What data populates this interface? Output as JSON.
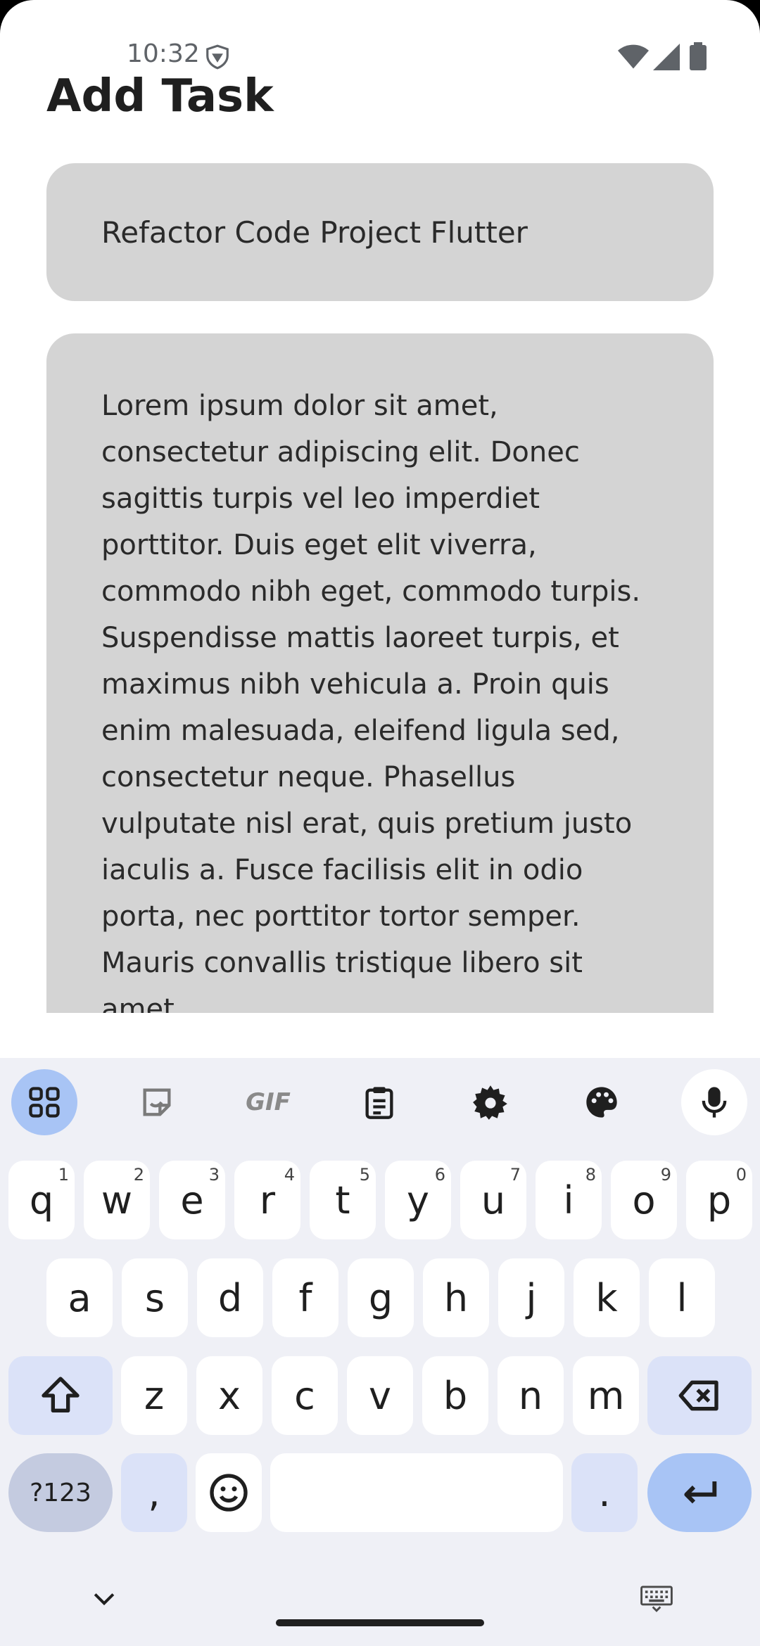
{
  "status_bar": {
    "time": "10:32"
  },
  "page": {
    "title": "Add Task"
  },
  "form": {
    "task_title_value": "Refactor Code Project Flutter",
    "description_value": "Lorem ipsum dolor sit amet, consectetur adipiscing elit. Donec sagittis turpis vel leo imperdiet porttitor. Duis eget elit viverra, commodo nibh eget, commodo turpis. Suspendisse mattis laoreet turpis, et maximus nibh vehicula a. Proin quis enim malesuada, eleifend ligula sed, consectetur neque. Phasellus vulputate nisl erat, quis pretium justo iaculis a. Fusce facilisis elit in odio porta, nec porttitor tortor semper. Mauris convallis tristique libero sit amet"
  },
  "keyboard": {
    "toolbar": {
      "apps_icon": "apps-grid-icon",
      "sticker_icon": "sticker-icon",
      "gif_label": "GIF",
      "clipboard_icon": "clipboard-icon",
      "settings_icon": "gear-icon",
      "theme_icon": "palette-icon",
      "mic_icon": "microphone-icon"
    },
    "row1": [
      {
        "key": "q",
        "hint": "1"
      },
      {
        "key": "w",
        "hint": "2"
      },
      {
        "key": "e",
        "hint": "3"
      },
      {
        "key": "r",
        "hint": "4"
      },
      {
        "key": "t",
        "hint": "5"
      },
      {
        "key": "y",
        "hint": "6"
      },
      {
        "key": "u",
        "hint": "7"
      },
      {
        "key": "i",
        "hint": "8"
      },
      {
        "key": "o",
        "hint": "9"
      },
      {
        "key": "p",
        "hint": "0"
      }
    ],
    "row2": [
      "a",
      "s",
      "d",
      "f",
      "g",
      "h",
      "j",
      "k",
      "l"
    ],
    "row3": [
      "z",
      "x",
      "c",
      "v",
      "b",
      "n",
      "m"
    ],
    "bottom": {
      "symbols": "?123",
      "comma": ",",
      "period": "."
    },
    "accent_color": "#a8c4f5"
  }
}
